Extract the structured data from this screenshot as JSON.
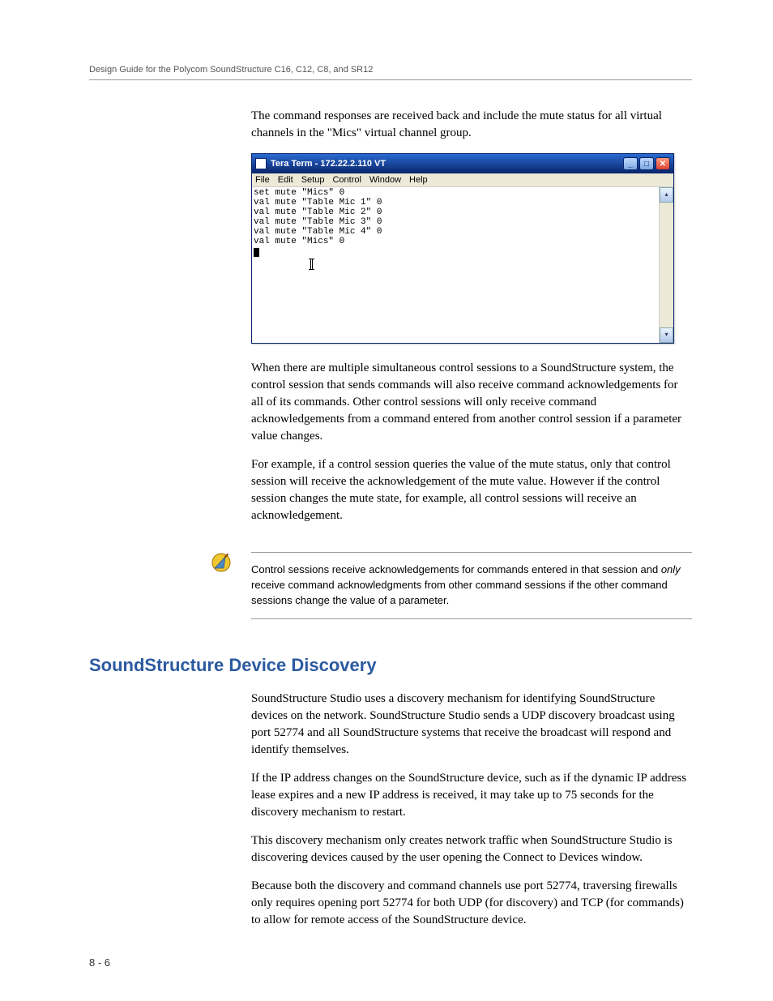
{
  "header": {
    "title": "Design Guide for the Polycom SoundStructure C16, C12, C8, and SR12"
  },
  "para1": "The command responses are received back and include the mute status for all virtual channels in the \"Mics\" virtual channel group.",
  "terminal": {
    "title": "Tera Term - 172.22.2.110 VT",
    "menu": [
      "File",
      "Edit",
      "Setup",
      "Control",
      "Window",
      "Help"
    ],
    "lines": [
      "set mute \"Mics\" 0",
      "val mute \"Table Mic 1\" 0",
      "val mute \"Table Mic 2\" 0",
      "val mute \"Table Mic 3\" 0",
      "val mute \"Table Mic 4\" 0",
      "val mute \"Mics\" 0"
    ]
  },
  "para2": "When there are multiple simultaneous control sessions to a SoundStructure system, the control session that sends commands will also receive command acknowledgements for all of its commands. Other control sessions will only receive command acknowledgements from a command entered from another control session if a parameter value changes.",
  "para3": "For example, if a control session queries the value of the mute status, only that control session will receive the acknowledgement of the mute value. However if the control session changes the mute state, for example, all control sessions will receive an acknowledgement.",
  "note": {
    "prefix": "Control sessions receive acknowledgements for commands entered in that session and ",
    "italic": "only",
    "suffix": " receive command acknowledgments from other command sessions if the other command sessions change the value of a parameter."
  },
  "section_heading": "SoundStructure Device Discovery",
  "para4": "SoundStructure Studio uses a discovery mechanism for identifying Sound­Structure devices on the network. SoundStructure Studio sends a UDP discovery broadcast using port 52774 and all SoundStructure systems that receive the broadcast will respond and identify themselves.",
  "para5": "If the IP address changes on the SoundStructure device, such as if the dynamic IP address lease expires and a new IP address is received, it may take up to 75 seconds for the discovery mechanism to restart.",
  "para6": "This discovery mechanism only creates network traffic when SoundStructure Studio is discovering devices caused by the user opening the Connect to Devices window.",
  "para7": "Because both the discovery and command channels use port 52774, traversing firewalls only requires opening port 52774 for both UDP (for discovery) and TCP (for commands) to allow for remote access of the SoundStructure device.",
  "footer": "8 - 6"
}
